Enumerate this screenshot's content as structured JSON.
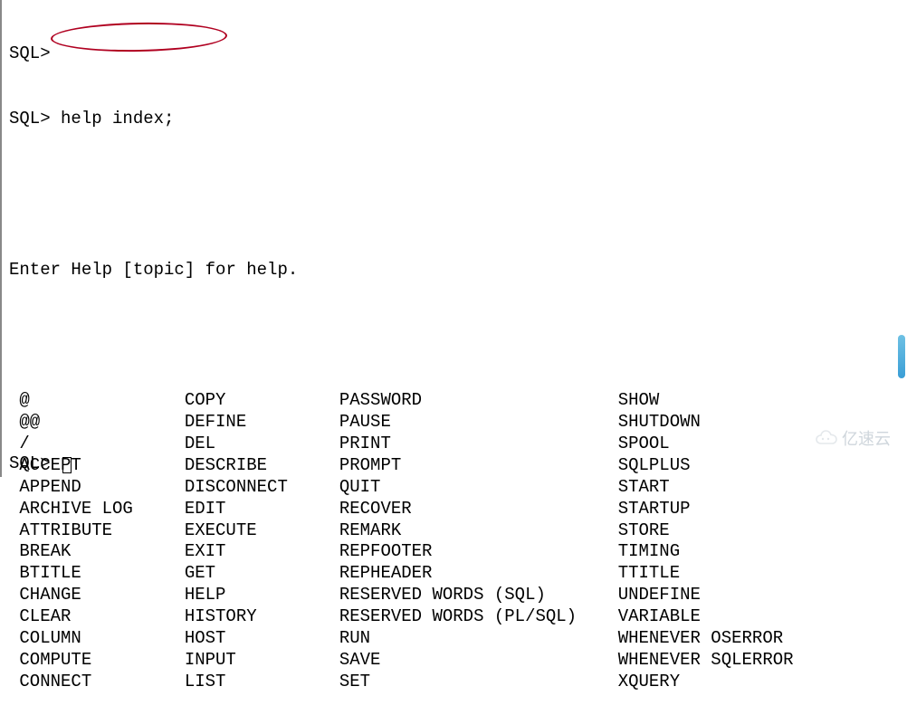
{
  "prompt": "SQL>",
  "command": "help index;",
  "instruction": "Enter Help [topic] for help.",
  "columns": [
    [
      "@",
      "@@",
      "/",
      "ACCEPT",
      "APPEND",
      "ARCHIVE LOG",
      "ATTRIBUTE",
      "BREAK",
      "BTITLE",
      "CHANGE",
      "CLEAR",
      "COLUMN",
      "COMPUTE",
      "CONNECT"
    ],
    [
      "COPY",
      "DEFINE",
      "DEL",
      "DESCRIBE",
      "DISCONNECT",
      "EDIT",
      "EXECUTE",
      "EXIT",
      "GET",
      "HELP",
      "HISTORY",
      "HOST",
      "INPUT",
      "LIST"
    ],
    [
      "PASSWORD",
      "PAUSE",
      "PRINT",
      "PROMPT",
      "QUIT",
      "RECOVER",
      "REMARK",
      "REPFOOTER",
      "REPHEADER",
      "RESERVED WORDS (SQL)",
      "RESERVED WORDS (PL/SQL)",
      "RUN",
      "SAVE",
      "SET"
    ],
    [
      "SHOW",
      "SHUTDOWN",
      "SPOOL",
      "SQLPLUS",
      "START",
      "STARTUP",
      "STORE",
      "TIMING",
      "TTITLE",
      "UNDEFINE",
      "VARIABLE",
      "WHENEVER OSERROR",
      "WHENEVER SQLERROR",
      "XQUERY"
    ]
  ],
  "watermark_text": "亿速云",
  "annotation_color": "#b00020"
}
